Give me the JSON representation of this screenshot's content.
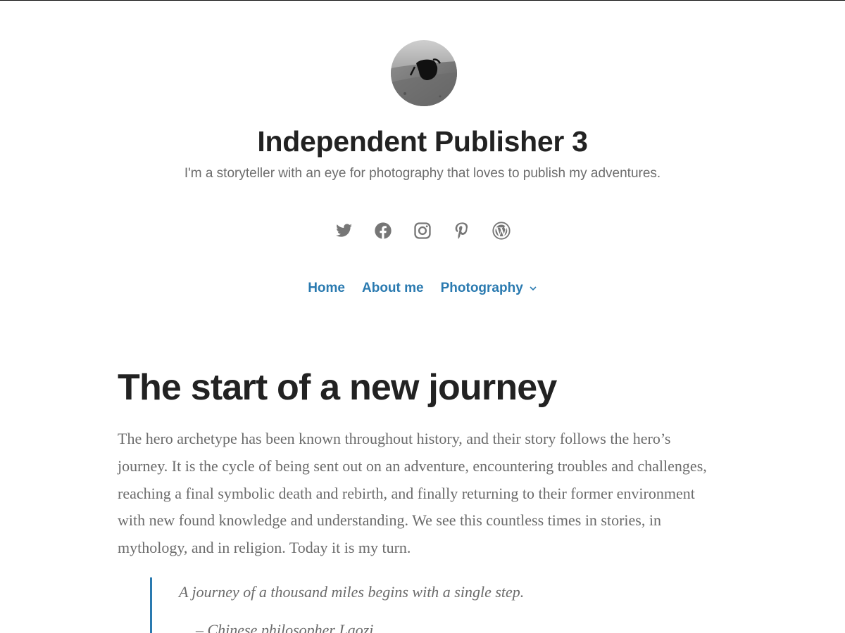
{
  "site": {
    "title": "Independent Publisher 3",
    "tagline": "I'm a storyteller with an eye for photography that loves to publish my adventures.",
    "avatar_icon": "avatar-sunglasses-photo"
  },
  "social": [
    {
      "name": "twitter-icon",
      "label": "Twitter"
    },
    {
      "name": "facebook-icon",
      "label": "Facebook"
    },
    {
      "name": "instagram-icon",
      "label": "Instagram"
    },
    {
      "name": "pinterest-icon",
      "label": "Pinterest"
    },
    {
      "name": "wordpress-icon",
      "label": "WordPress"
    }
  ],
  "nav": {
    "items": [
      {
        "label": "Home"
      },
      {
        "label": "About me"
      },
      {
        "label": "Photography",
        "has_submenu": true
      }
    ]
  },
  "post": {
    "title": "The start of a new journey",
    "body": "The hero archetype has been known throughout history, and their story follows the hero’s journey. It is the cycle of being sent out on an adventure, encountering troubles and challenges, reaching a final symbolic death and rebirth, and finally returning to their former environment with new found knowledge and understanding. We see this countless times in stories, in mythology, and in religion. Today it is my turn.",
    "quote": "A journey of a thousand miles begins with a single step.",
    "quote_cite": "– Chinese philosopher Laozi"
  },
  "colors": {
    "link": "#2a7ab0",
    "title": "#222222",
    "text": "#6b6b6b",
    "icon": "#767676",
    "quote_border": "#2a7ab0"
  }
}
